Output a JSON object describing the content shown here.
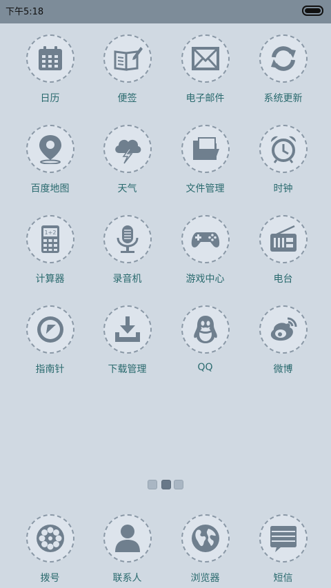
{
  "status_bar": {
    "time": "下午5:18"
  },
  "apps": [
    {
      "label": "日历",
      "icon": "calendar-icon"
    },
    {
      "label": "便签",
      "icon": "notebook-icon"
    },
    {
      "label": "电子邮件",
      "icon": "envelope-icon"
    },
    {
      "label": "系统更新",
      "icon": "refresh-icon"
    },
    {
      "label": "百度地图",
      "icon": "map-pin-icon"
    },
    {
      "label": "天气",
      "icon": "storm-cloud-icon"
    },
    {
      "label": "文件管理",
      "icon": "folder-icon"
    },
    {
      "label": "时钟",
      "icon": "alarm-clock-icon"
    },
    {
      "label": "计算器",
      "icon": "calculator-icon"
    },
    {
      "label": "录音机",
      "icon": "microphone-icon"
    },
    {
      "label": "游戏中心",
      "icon": "gamepad-icon"
    },
    {
      "label": "电台",
      "icon": "radio-icon"
    },
    {
      "label": "指南针",
      "icon": "compass-icon"
    },
    {
      "label": "下载管理",
      "icon": "download-icon"
    },
    {
      "label": "QQ",
      "icon": "penguin-icon"
    },
    {
      "label": "微博",
      "icon": "weibo-icon"
    }
  ],
  "page_indicator": {
    "count": 3,
    "active": 2
  },
  "dock": [
    {
      "label": "拨号",
      "icon": "dialer-icon"
    },
    {
      "label": "联系人",
      "icon": "person-icon"
    },
    {
      "label": "浏览器",
      "icon": "globe-icon"
    },
    {
      "label": "短信",
      "icon": "message-icon"
    }
  ]
}
